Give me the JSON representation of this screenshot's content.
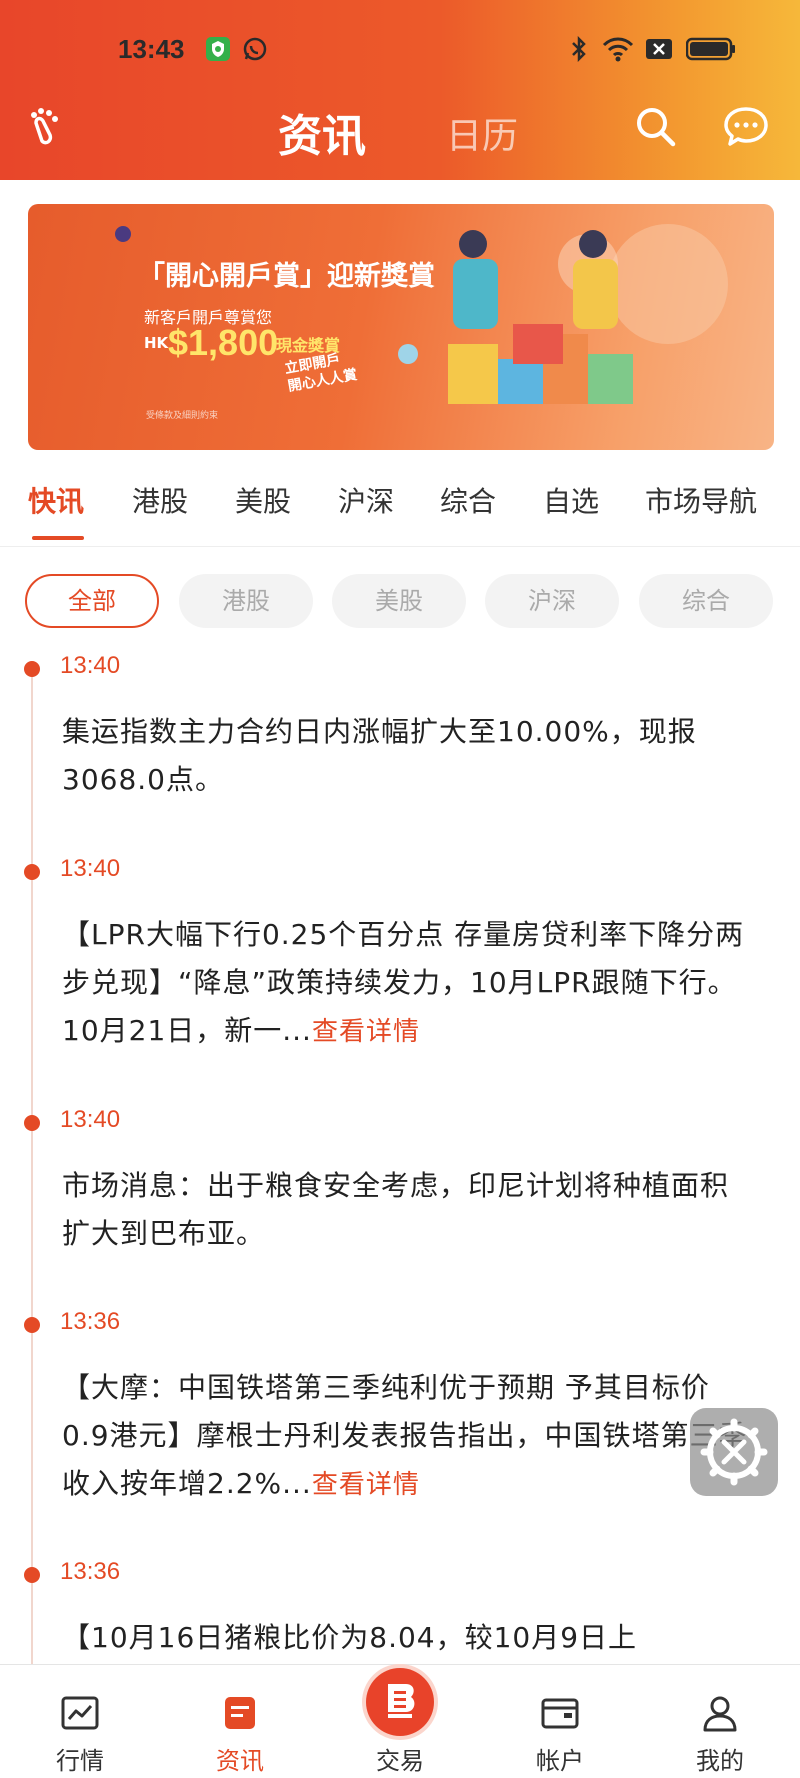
{
  "status_bar": {
    "time": "13:43"
  },
  "nav": {
    "tab_main": "资讯",
    "tab_calendar": "日历"
  },
  "banner": {
    "title": "「開心開戶賞」迎新獎賞",
    "subtitle": "新客戶開戶尊賞您",
    "currency": "HK",
    "amount": "$1,800",
    "cash_label": "現金獎賞",
    "stamp_line1": "立即開戶",
    "stamp_line2": "開心人人賞",
    "fine_print": "受條款及細則約束"
  },
  "category_tabs": [
    "快讯",
    "港股",
    "美股",
    "沪深",
    "综合",
    "自选",
    "市场导航"
  ],
  "active_category": "快讯",
  "filters": [
    "全部",
    "港股",
    "美股",
    "沪深",
    "综合"
  ],
  "active_filter": "全部",
  "news": [
    {
      "time": "13:40",
      "text": "集运指数主力合约日内涨幅扩大至10.00%，现报3068.0点。",
      "more": ""
    },
    {
      "time": "13:40",
      "text": "【LPR大幅下行0.25个百分点 存量房贷利率下降分两步兑现】“降息”政策持续发力，10月LPR跟随下行。10月21日，新一...",
      "more": "查看详情"
    },
    {
      "time": "13:40",
      "text": "市场消息：出于粮食安全考虑，印尼计划将种植面积扩大到巴布亚。",
      "more": ""
    },
    {
      "time": "13:36",
      "text": "【大摩：中国铁塔第三季纯利优于预期 予其目标价0.9港元】摩根士丹利发表报告指出，中国铁塔第三季收入按年增2.2%...",
      "more": "查看详情"
    },
    {
      "time": "13:36",
      "text": "【10月16日猪粮比价为8.04，较10月9日上",
      "more": ""
    }
  ],
  "bottom_nav": [
    {
      "label": "行情",
      "icon": "chart-icon"
    },
    {
      "label": "资讯",
      "icon": "news-icon"
    },
    {
      "label": "交易",
      "icon": "trade-icon"
    },
    {
      "label": "帐户",
      "icon": "wallet-icon"
    },
    {
      "label": "我的",
      "icon": "person-icon"
    }
  ],
  "colors": {
    "accent": "#e44a25",
    "header_start": "#e8462a",
    "header_end": "#f6b83a"
  }
}
